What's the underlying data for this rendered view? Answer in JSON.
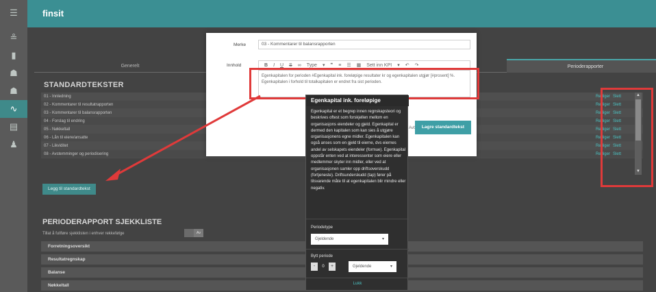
{
  "app": {
    "brand": "finsit"
  },
  "rail": {
    "items": [
      {
        "icon": "menu-icon",
        "glyph": "☰",
        "active": false
      },
      {
        "icon": "users-icon",
        "glyph": "👥",
        "active": false
      },
      {
        "icon": "chart-icon",
        "glyph": "▮",
        "active": false
      },
      {
        "icon": "people-icon",
        "glyph": "👥",
        "active": false
      },
      {
        "icon": "team-icon",
        "glyph": "👥",
        "active": false
      },
      {
        "icon": "pulse-icon",
        "glyph": "⚕",
        "active": true
      },
      {
        "icon": "archive-icon",
        "glyph": "▤",
        "active": false
      },
      {
        "icon": "user-icon",
        "glyph": "👤",
        "active": false
      }
    ]
  },
  "tabs": {
    "general": "Generelt",
    "period": "Perioderapporter"
  },
  "standard": {
    "heading": "STANDARDTEKSTER",
    "rows": [
      "01 - Innledning",
      "02 - Kommentarer til resultatrapporten",
      "03 - Kommentarer til balansrapporten",
      "04 - Forslag til endring",
      "05 - Nøkkeltall",
      "06 - Lån til eiere/ansatte",
      "07 - Likviditet",
      "08 - Avstemminger og periodisering"
    ],
    "edit_label": "Rediger",
    "delete_label": "Slett",
    "add_button": "Legg til standardtekst"
  },
  "checklist": {
    "heading": "PERIODERAPPORT SJEKKLISTE",
    "allow_label": "Tillat å fullføre sjekklisten i enhver rekkefølge",
    "toggle_label": "Av",
    "sections": [
      "Forretningsoversikt",
      "Resultatregnskap",
      "Balanse",
      "Nøkkeltall"
    ]
  },
  "modal": {
    "label_name": "Merke",
    "name_value": "03 - Kommentarer til balansrapporten",
    "label_content": "Innhold",
    "toolbar": {
      "bold": "B",
      "italic": "I",
      "underline": "U",
      "strike": "S",
      "link": "🔗",
      "type": "Type",
      "quote": "❞",
      "ol": "⒈",
      "ul": "☰",
      "table": "▦",
      "insert_kpi": "Sett inn KPI",
      "undo": "↶",
      "redo": "↷"
    },
    "content": "Egenkapitalen for perioden #Egenkapital ink. foreløpige resultater kr og egenkapitalen utgjør [#prosent] %. Egenkapitalen i forhold til totalkapitalen er endret fra sist perioden.",
    "save_button": "Lagre standardtekst",
    "cancel_label": "Avbryt"
  },
  "tooltip": {
    "title": "Egenkapital ink. foreløpige",
    "body": "Egenkapital er et begrep innen regnskapsteori og beskrives oftest som forskjellen mellom en organisasjons eiendeler og gjeld. Egenkapital er dermed den kapitalen som kan sies å utgjøre organisasjonens egne midler. Egenkapitalen kan også anses som en gjeld til eierne, dvs eiernes andel av selskapets eiendeler (formue). Egenkapital oppstår enten ved at interessenter som eiere eller medlemmer skyter inn midler, eller ved at organisasjonen samler opp driftsoverskudd (fortjeneste). Driftsunderskudd (tap) fører på tilsvarende måte til at egenkapitalen blir mindre eller negativ.",
    "period_type_label": "Periodetype",
    "period_type_value": "Gjeldende",
    "switch_period_label": "Bytt periode",
    "stepper_value": "0",
    "stepper_minus": "-",
    "stepper_plus": "+",
    "switch_value": "Gjeldende",
    "close_label": "Lukk"
  },
  "colors": {
    "accent": "#3b8f93",
    "annotation": "#e03a3a",
    "link": "#4cc3c3"
  }
}
